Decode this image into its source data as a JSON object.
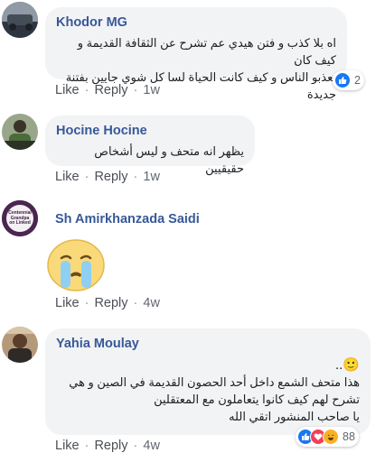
{
  "comments": [
    {
      "author": "Khodor MG",
      "text_lines": [
        "اه بلا كذب و فتن هيدي عم تشرح عن الثقافة القديمة و كيف كان",
        "يعذبو الناس و كيف كانت الحياة لسا كل شوي جايين بفتنة جديدة"
      ],
      "like": "Like",
      "reply": "Reply",
      "time": "1w",
      "reactions": {
        "types": [
          "like"
        ],
        "count": "2"
      },
      "colors": {
        "avatar": "#5a6470"
      }
    },
    {
      "author": "Hocine Hocine",
      "text_lines": [
        "يظهر انه متحف و ليس أشخاص حقيقيين"
      ],
      "like": "Like",
      "reply": "Reply",
      "time": "1w",
      "colors": {
        "avatar": "#6f7c58"
      }
    },
    {
      "author": "Sh Amirkhanzada Saidi",
      "avatar_text": "Centennial Grandpa on Linked",
      "sticker": "crying-face-sticker",
      "like": "Like",
      "reply": "Reply",
      "time": "4w",
      "colors": {
        "avatar": "#3a1f3f"
      }
    },
    {
      "author": "Yahia Moulay",
      "emoji": "🙂..",
      "text_lines": [
        "هذا متحف الشمع داخل أحد الحصون القديمة في الصين و هي",
        "تشرح لهم كيف كانوا يتعاملون مع المعتقلين",
        "يا صاحب المنشور اتقي الله"
      ],
      "like": "Like",
      "reply": "Reply",
      "time": "4w",
      "reactions": {
        "types": [
          "like",
          "love",
          "haha"
        ],
        "count": "88"
      },
      "colors": {
        "avatar": "#8a6a50"
      }
    }
  ],
  "colors": {
    "name": "#385898",
    "bubble": "#f2f3f5",
    "like_blue": "#1877f2",
    "love_red": "#f33e58",
    "haha_yellow": "#f7b125"
  }
}
